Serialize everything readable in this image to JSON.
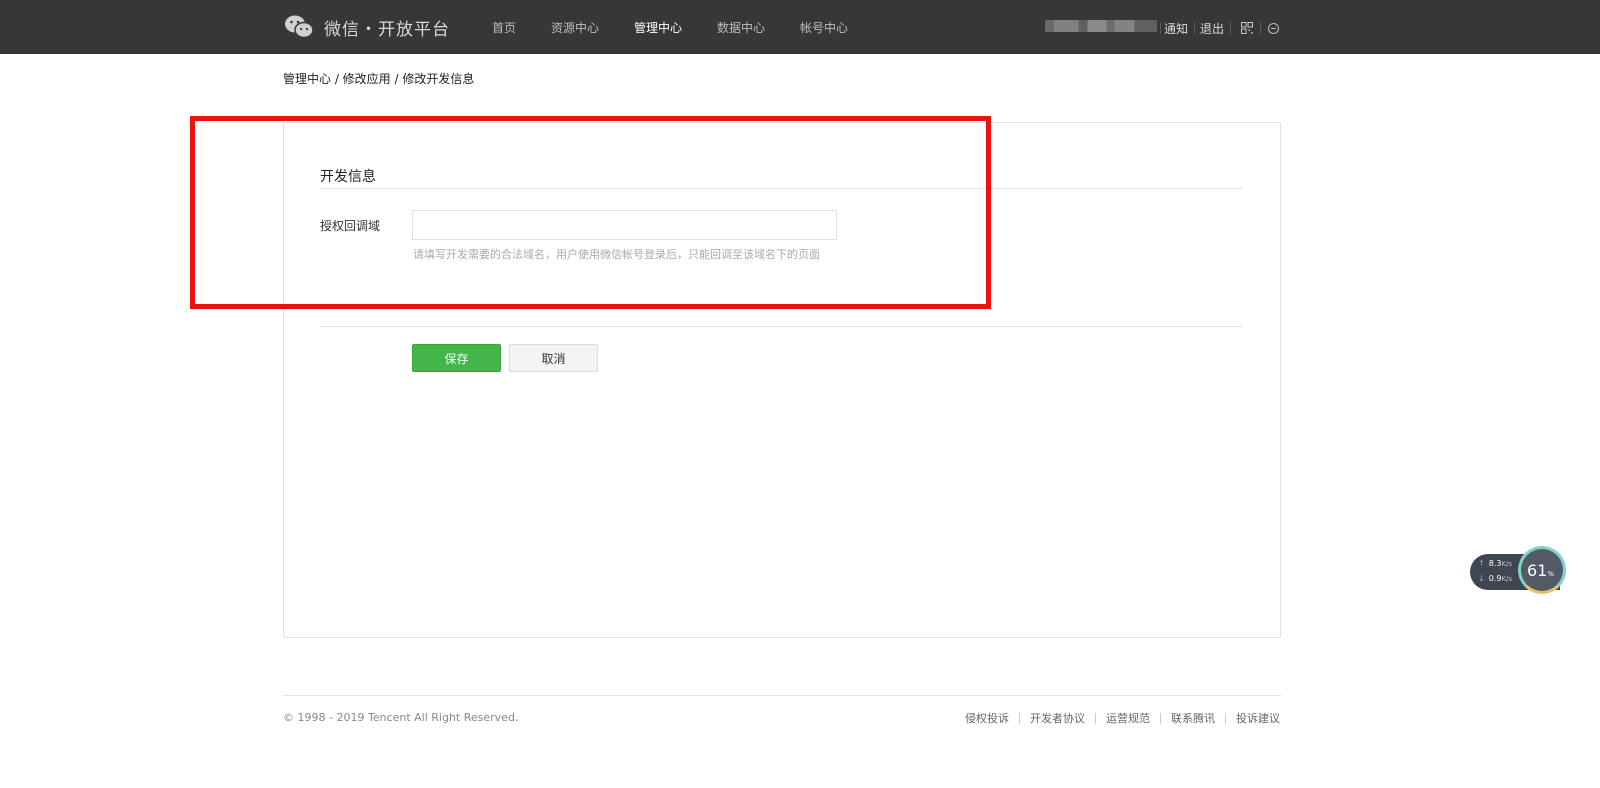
{
  "header": {
    "brand": "微信・开放平台",
    "nav": [
      {
        "label": "首页",
        "active": false
      },
      {
        "label": "资源中心",
        "active": false
      },
      {
        "label": "管理中心",
        "active": true
      },
      {
        "label": "数据中心",
        "active": false
      },
      {
        "label": "帐号中心",
        "active": false
      }
    ],
    "notify_label": "通知",
    "logout_label": "退出",
    "icons": [
      "wechat-logo-icon",
      "qrcode-icon",
      "globe-icon"
    ]
  },
  "breadcrumb": "管理中心 / 修改应用 / 修改开发信息",
  "form": {
    "section_title": "开发信息",
    "callback_label": "授权回调域",
    "callback_value": "",
    "hint": "请填写开发需要的合法域名，用户使用微信帐号登录后，只能回调至该域名下的页面",
    "save_label": "保存",
    "cancel_label": "取消"
  },
  "footer": {
    "copyright": "© 1998 - 2019 Tencent All Right Reserved.",
    "links": [
      "侵权投诉",
      "开发者协议",
      "运营规范",
      "联系腾讯",
      "投诉建议"
    ]
  },
  "net_widget": {
    "upload": "8.3",
    "download": "0.9",
    "unit": "K/s",
    "percent": "61",
    "percent_unit": "%"
  },
  "colors": {
    "topbar": "#373737",
    "accent_green": "#44b549",
    "highlight_red": "#ee1111"
  }
}
